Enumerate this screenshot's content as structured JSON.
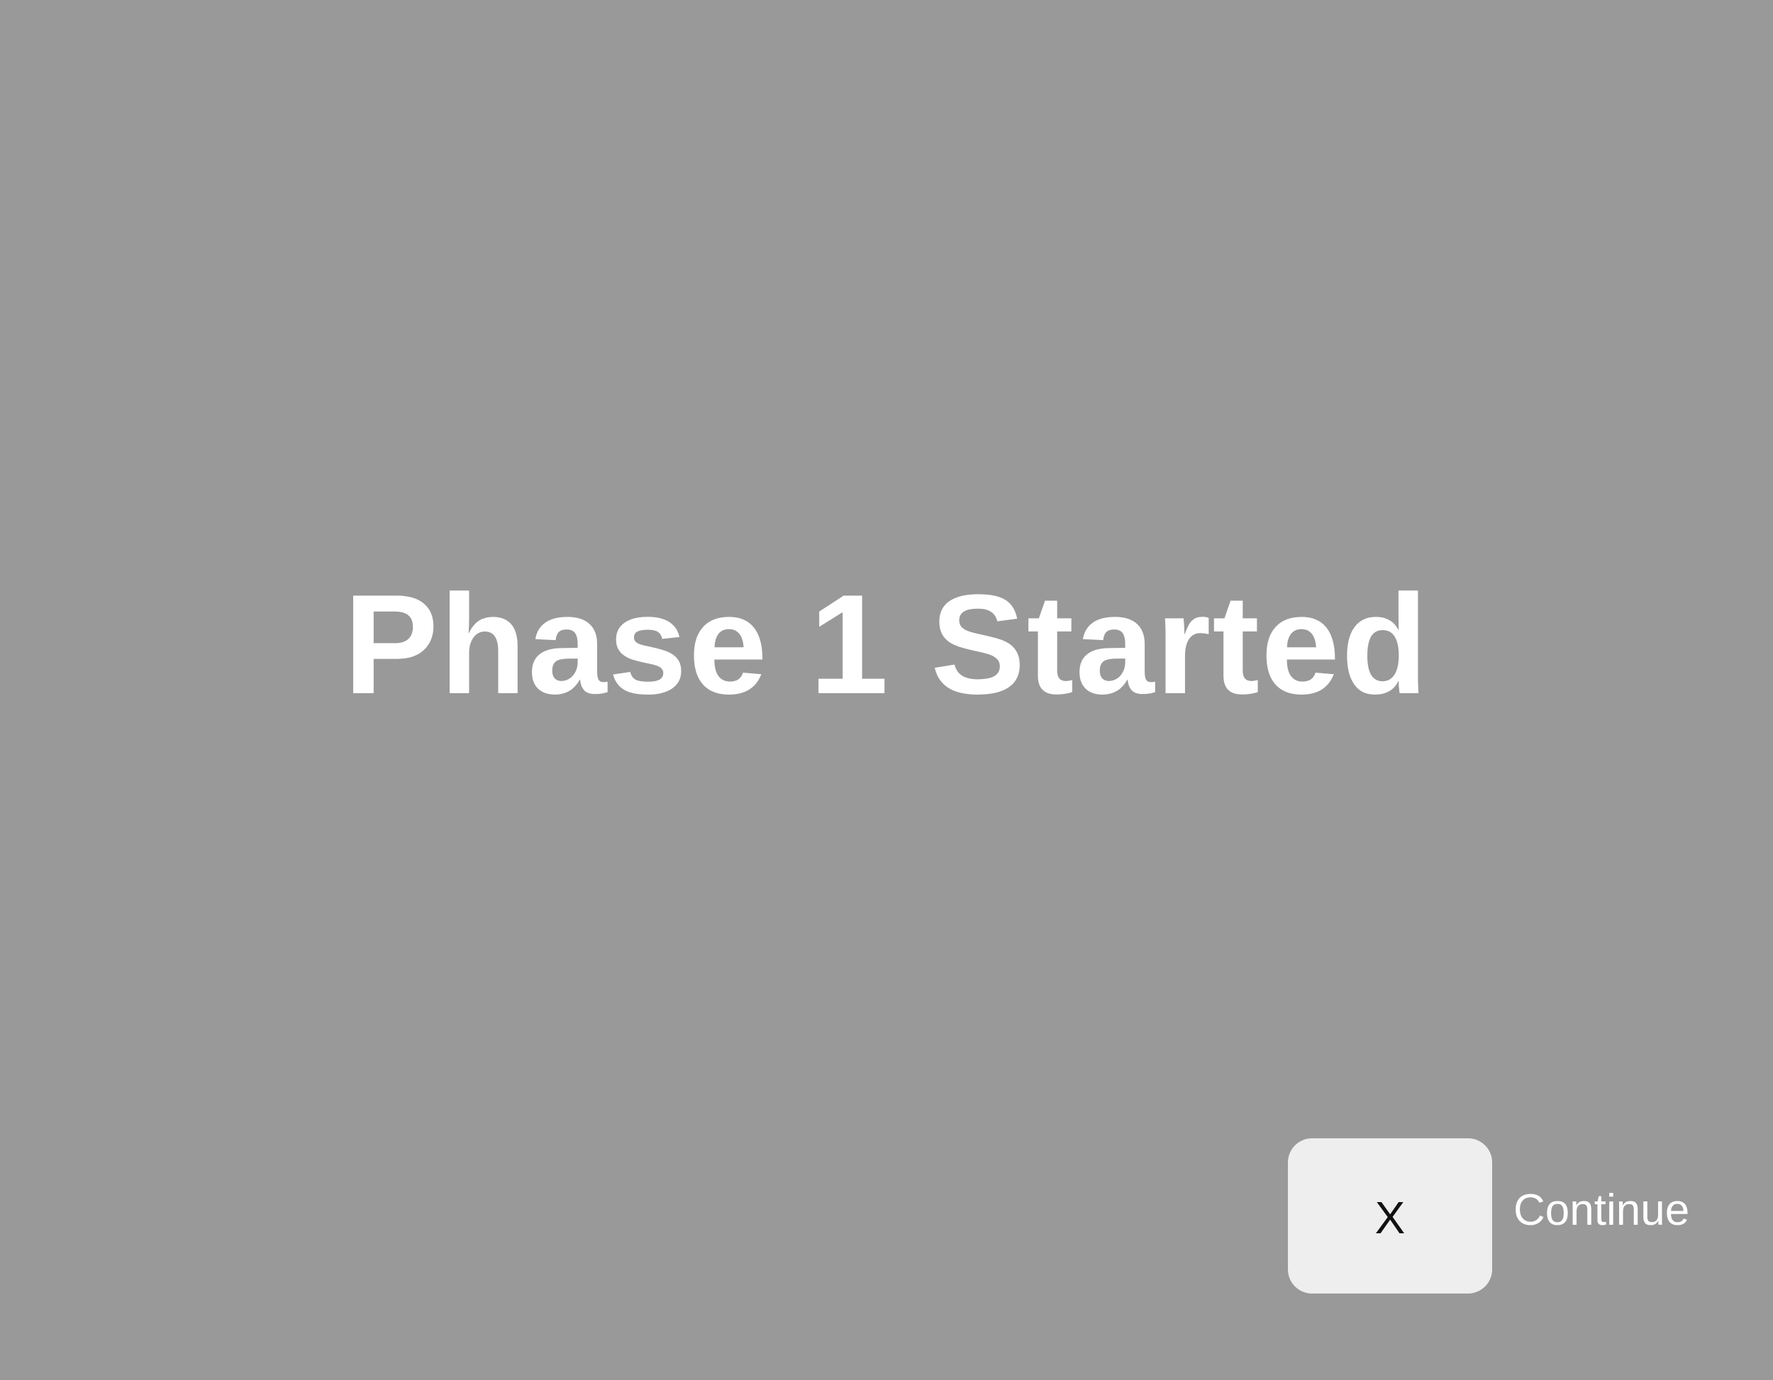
{
  "screen": {
    "title": "Phase 1 Started"
  },
  "continue_control": {
    "key_label": "X",
    "action_label": "Continue"
  },
  "colors": {
    "background": "#999999",
    "title_text": "#ffffff",
    "key_button_bg": "#eeeeee",
    "key_button_text": "#111111"
  }
}
